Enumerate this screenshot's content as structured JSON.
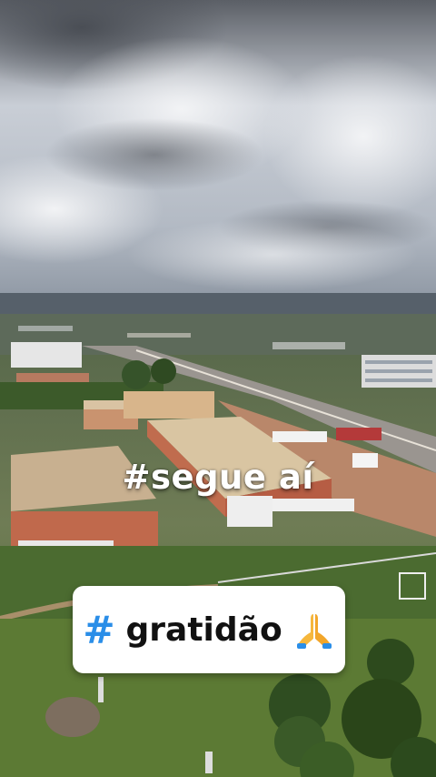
{
  "overlay": {
    "caption": "#segue aí"
  },
  "sticker": {
    "hash_symbol": "#",
    "word": "gratidão",
    "emoji": "praying-hands-icon"
  },
  "colors": {
    "hashtag_blue": "#2a8ee8",
    "sticker_bg": "#ffffff",
    "sky": "#c7ccd3",
    "grass": "#5a7a3a"
  }
}
